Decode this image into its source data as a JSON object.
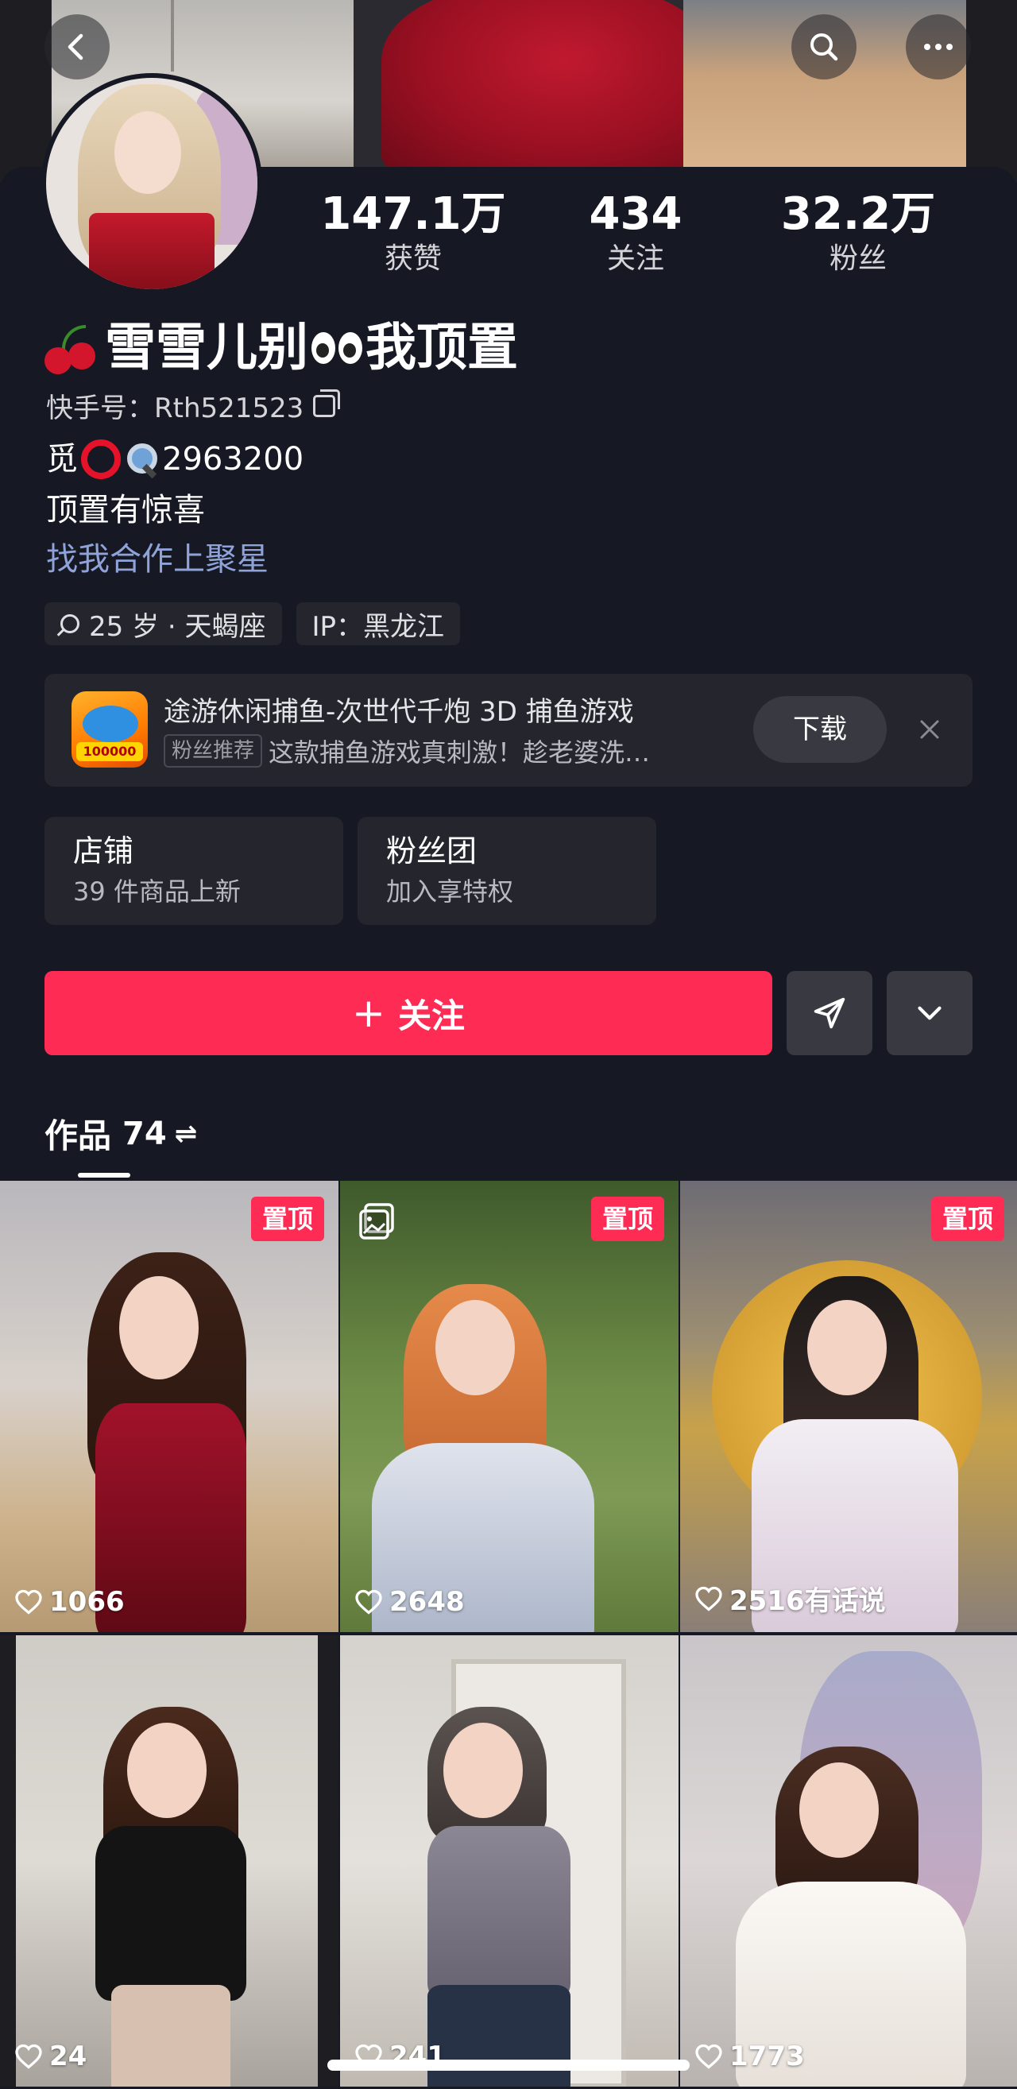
{
  "header": {
    "back_icon": "chevron-left-icon",
    "search_icon": "search-icon",
    "more_icon": "more-icon"
  },
  "profile": {
    "stats": [
      {
        "num": "147.1万",
        "label": "获赞"
      },
      {
        "num": "434",
        "label": "关注"
      },
      {
        "num": "32.2万",
        "label": "粉丝"
      }
    ],
    "name": "雪雪儿别",
    "name_suffix": "我顶置",
    "kuaishou_id": "快手号：Rth521523",
    "bio_line1_prefix": "觅",
    "bio_line1_number": "2963200",
    "bio_line2": "顶置有惊喜",
    "bio_line3": "找我合作上聚星",
    "tags": [
      "25 岁 · 天蝎座",
      "IP：黑龙江"
    ]
  },
  "ad": {
    "title": "途游休闲捕鱼-次世代千炮 3D 捕鱼游戏",
    "badge": "粉丝推荐",
    "desc": "这款捕鱼游戏真刺激！趁老婆洗…",
    "download_label": "下载",
    "icon_badge": "100000"
  },
  "cards": [
    {
      "title": "店铺",
      "sub": "39 件商品上新"
    },
    {
      "title": "粉丝团",
      "sub": "加入享特权"
    }
  ],
  "actions": {
    "follow_plus": "+",
    "follow_label": "关注"
  },
  "works": {
    "label": "作品",
    "count": "74",
    "switch_glyph": "⇌"
  },
  "grid": [
    {
      "pin": "置顶",
      "likes": "1066"
    },
    {
      "pin": "置顶",
      "likes": "2648"
    },
    {
      "pin": "置顶",
      "likes": "2516有话说"
    },
    {
      "pin": "",
      "likes": "24"
    },
    {
      "pin": "",
      "likes": "241"
    },
    {
      "pin": "",
      "likes": "1773"
    }
  ],
  "colors": {
    "background": "#161823",
    "accent": "#fe2c55",
    "link": "#8fa3d9",
    "surface": "#25252d"
  }
}
